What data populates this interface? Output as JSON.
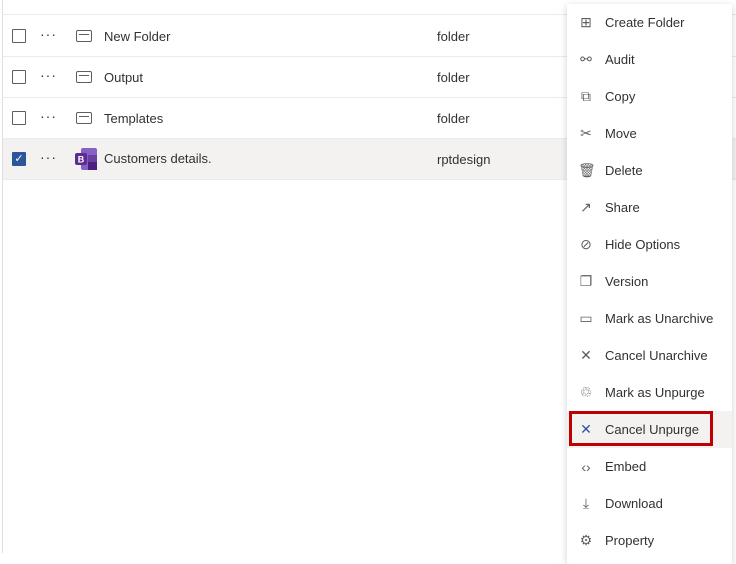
{
  "rows": [
    {
      "name": "New Folder",
      "type": "folder",
      "checked": false,
      "icon": "folder-icon"
    },
    {
      "name": "Output",
      "type": "folder",
      "checked": false,
      "icon": "folder-icon"
    },
    {
      "name": "Templates",
      "type": "folder",
      "checked": false,
      "icon": "folder-icon"
    },
    {
      "name": "Customers details.",
      "type": "rptdesign",
      "checked": true,
      "icon": "birt-report-icon"
    }
  ],
  "more_label": "···",
  "check_mark": "✓",
  "menu": [
    {
      "label": "Create Folder",
      "icon": "⊞"
    },
    {
      "label": "Audit",
      "icon": "⚯"
    },
    {
      "label": "Copy",
      "icon": "⧉"
    },
    {
      "label": "Move",
      "icon": "✂"
    },
    {
      "label": "Delete",
      "icon": "🗑"
    },
    {
      "label": "Share",
      "icon": "↗"
    },
    {
      "label": "Hide Options",
      "icon": "⊘"
    },
    {
      "label": "Version",
      "icon": "❐"
    },
    {
      "label": "Mark as Unarchive",
      "icon": "▭"
    },
    {
      "label": "Cancel Unarchive",
      "icon": "✕"
    },
    {
      "label": "Mark as Unpurge",
      "icon": "♲"
    },
    {
      "label": "Cancel Unpurge",
      "icon": "✕"
    },
    {
      "label": "Embed",
      "icon": "‹›"
    },
    {
      "label": "Download",
      "icon": "⤓"
    },
    {
      "label": "Property",
      "icon": "⚙"
    }
  ],
  "highlight_color": "#c00000"
}
